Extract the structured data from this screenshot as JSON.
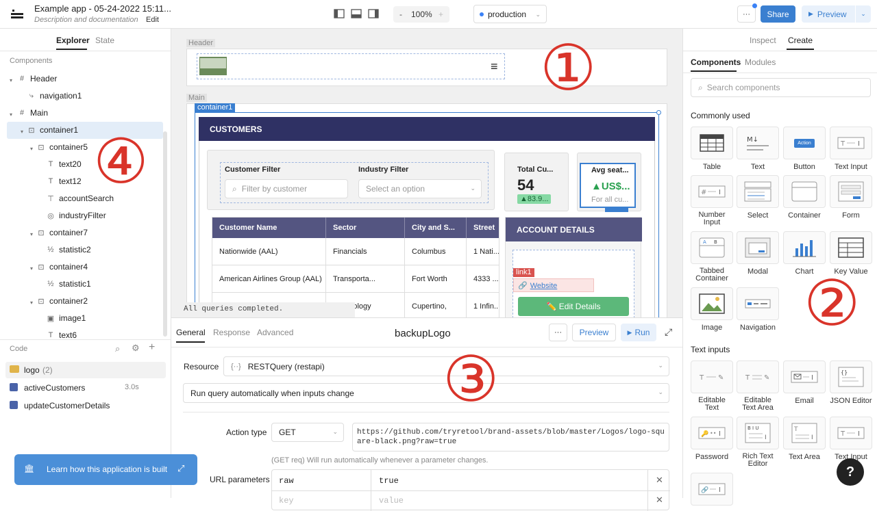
{
  "topbar": {
    "app_title": "Example app - 05-24-2022 15:11...",
    "subtitle": "Description and documentation",
    "edit_label": "Edit",
    "zoom_minus": "-",
    "zoom": "100%",
    "zoom_plus": "+",
    "environment": "production",
    "more": "···",
    "share": "Share",
    "preview": "Preview"
  },
  "explorer": {
    "tabs": [
      "Explorer",
      "State"
    ],
    "section_title": "Components",
    "tree": [
      {
        "label": "Header"
      },
      {
        "label": "navigation1"
      },
      {
        "label": "Main"
      },
      {
        "label": "container1"
      },
      {
        "label": "container5"
      },
      {
        "label": "text20"
      },
      {
        "label": "text12"
      },
      {
        "label": "accountSearch"
      },
      {
        "label": "industryFilter"
      },
      {
        "label": "container7"
      },
      {
        "label": "statistic2"
      },
      {
        "label": "container4"
      },
      {
        "label": "statistic1"
      },
      {
        "label": "container2"
      },
      {
        "label": "image1"
      },
      {
        "label": "text6"
      }
    ],
    "code_title": "Code",
    "queries": [
      {
        "name": "logo",
        "count": "(2)",
        "time": ""
      },
      {
        "name": "activeCustomers",
        "count": "",
        "time": "3.0s"
      },
      {
        "name": "updateCustomerDetails",
        "count": "",
        "time": ""
      }
    ],
    "learn_label": "Learn how this application is built"
  },
  "canvas": {
    "header_label": "Header",
    "main_label": "Main",
    "container_tag": "container1",
    "customers_title": "CUSTOMERS",
    "customer_filter_label": "Customer Filter",
    "customer_filter_placeholder": "Filter by customer",
    "industry_filter_label": "Industry Filter",
    "industry_filter_placeholder": "Select an option",
    "stat1_label": "Total Cu...",
    "stat1_value": "54",
    "stat1_delta": "▲83.9...",
    "stat2_label": "Avg seat...",
    "stat2_value": "▲US$...",
    "stat2_sub": "For all cu...",
    "table_headers": [
      "Customer Name",
      "Sector",
      "City and S...",
      "Street"
    ],
    "table_rows": [
      [
        "Nationwide (AAL)",
        "Financials",
        "Columbus",
        "1 Nati..."
      ],
      [
        "American Airlines Group (AAL)",
        "Transporta...",
        "Fort Worth",
        "4333 ..."
      ],
      [
        "Apple (AAPL)",
        "Technology",
        "Cupertino,",
        "1 Infin..."
      ]
    ],
    "account_title": "ACCOUNT DETAILS",
    "link_tag": "link1",
    "link_text": "Website",
    "edit_button": "✏️ Edit Details",
    "status": "All queries completed.",
    "annot_1": "①",
    "annot_4": "④"
  },
  "inspector": {
    "tabs": [
      "Inspect",
      "Create"
    ],
    "subtabs": [
      "Components",
      "Modules"
    ],
    "search_placeholder": "Search components",
    "common_title": "Commonly used",
    "common": [
      {
        "label": "Table",
        "icon": "table-icon"
      },
      {
        "label": "Text",
        "icon": "text-icon"
      },
      {
        "label": "Button",
        "icon": "button-icon"
      },
      {
        "label": "Text Input",
        "icon": "text-input-icon"
      },
      {
        "label": "Number Input",
        "icon": "number-input-icon"
      },
      {
        "label": "Select",
        "icon": "select-icon"
      },
      {
        "label": "Container",
        "icon": "container-icon"
      },
      {
        "label": "Form",
        "icon": "form-icon"
      },
      {
        "label": "Tabbed Container",
        "icon": "tabbed-container-icon"
      },
      {
        "label": "Modal",
        "icon": "modal-icon"
      },
      {
        "label": "Chart",
        "icon": "chart-icon"
      },
      {
        "label": "Key Value",
        "icon": "key-value-icon"
      },
      {
        "label": "Image",
        "icon": "image-icon"
      },
      {
        "label": "Navigation",
        "icon": "navigation-icon"
      }
    ],
    "button_icon_text": "Action",
    "text_inputs_title": "Text inputs",
    "text_inputs": [
      {
        "label": "Editable Text"
      },
      {
        "label": "Editable Text Area"
      },
      {
        "label": "Email"
      },
      {
        "label": "JSON Editor"
      },
      {
        "label": "Password"
      },
      {
        "label": "Rich Text Editor"
      },
      {
        "label": "Text Area"
      },
      {
        "label": "Text Input"
      }
    ],
    "annot_2": "②",
    "help": "?"
  },
  "query_editor": {
    "tabs": [
      "General",
      "Response",
      "Advanced"
    ],
    "query_name": "backupLogo",
    "more": "···",
    "preview": "Preview",
    "run": "Run",
    "resource_label": "Resource",
    "resource_value": "RESTQuery (restapi)",
    "trigger_value": "Run query automatically when inputs change",
    "action_type_label": "Action type",
    "method": "GET",
    "url": "https://github.com/tryretool/brand-assets/blob/master/Logos/logo-square-black.png?raw=true",
    "hint": "(GET req) Will run automatically whenever a parameter changes.",
    "url_params_label": "URL parameters",
    "params": [
      {
        "key": "raw",
        "value": "true"
      },
      {
        "key": "key",
        "value": "value"
      }
    ],
    "annot_3": "③"
  }
}
